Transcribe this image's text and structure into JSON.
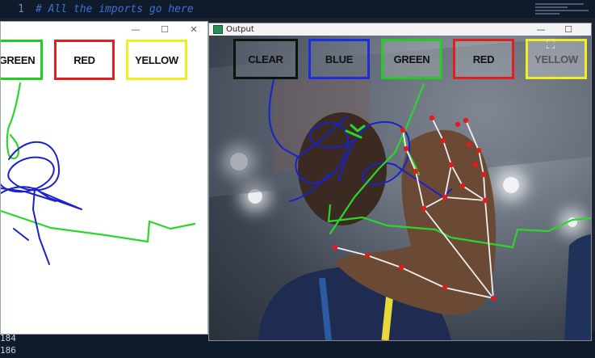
{
  "editor": {
    "line_number": "1",
    "comment": "# All the imports go here",
    "bottom_lines": [
      "184",
      "186"
    ]
  },
  "paint_window": {
    "controls": {
      "minimize": "—",
      "maximize": "☐",
      "close": "✕"
    },
    "buttons": [
      {
        "label": "GREEN",
        "color": "#22cc22"
      },
      {
        "label": "RED",
        "color": "#e02020"
      },
      {
        "label": "YELLOW",
        "color": "#eeee22"
      }
    ]
  },
  "output_window": {
    "title": "Output",
    "controls": {
      "minimize": "—",
      "maximize": "☐"
    },
    "buttons": [
      {
        "label": "CLEAR",
        "color": "#111111"
      },
      {
        "label": "BLUE",
        "color": "#1a2ee0"
      },
      {
        "label": "GREEN",
        "color": "#22cc22"
      },
      {
        "label": "RED",
        "color": "#e02020"
      },
      {
        "label": "YELLOW",
        "color": "#eeee22"
      }
    ]
  },
  "colors": {
    "stroke_blue": "#1a22c8",
    "stroke_green": "#2bd62b",
    "landmark_red": "#e41b1b",
    "skeleton": "#f0f0f0"
  }
}
